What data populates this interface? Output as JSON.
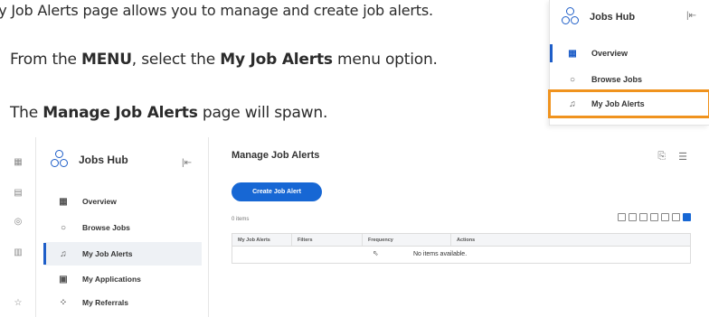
{
  "instructions": {
    "line0": "ly Job Alerts page allows you to manage and create job alerts.",
    "line1_a": "From the ",
    "line1_b": "MENU",
    "line1_c": ", select the ",
    "line1_d": "My Job Alerts",
    "line1_e": " menu option.",
    "line2_a": "The ",
    "line2_b": "Manage Job Alerts",
    "line2_c": " page will spawn."
  },
  "inset_menu": {
    "title": "Jobs Hub",
    "collapse_icon": "collapse-icon",
    "items": [
      {
        "label": "Overview",
        "icon": "grid-icon"
      },
      {
        "label": "Browse Jobs",
        "icon": "search-icon"
      },
      {
        "label": "My Job Alerts",
        "icon": "bell-icon"
      }
    ],
    "highlight_color": "#f0931e"
  },
  "menu": {
    "title": "Jobs Hub",
    "items": [
      {
        "label": "Overview",
        "icon": "grid-icon"
      },
      {
        "label": "Browse Jobs",
        "icon": "search-icon"
      },
      {
        "label": "My Job Alerts",
        "icon": "bell-icon"
      },
      {
        "label": "My Applications",
        "icon": "document-icon"
      },
      {
        "label": "My Referrals",
        "icon": "referral-icon"
      }
    ]
  },
  "main": {
    "page_title": "Manage Job Alerts",
    "create_button": "Create Job Alert",
    "items_count": "0 items",
    "columns": [
      "My Job Alerts",
      "Filters",
      "Frequency",
      "Actions"
    ],
    "empty_message": "No items available.",
    "accent_color": "#1767d4"
  }
}
